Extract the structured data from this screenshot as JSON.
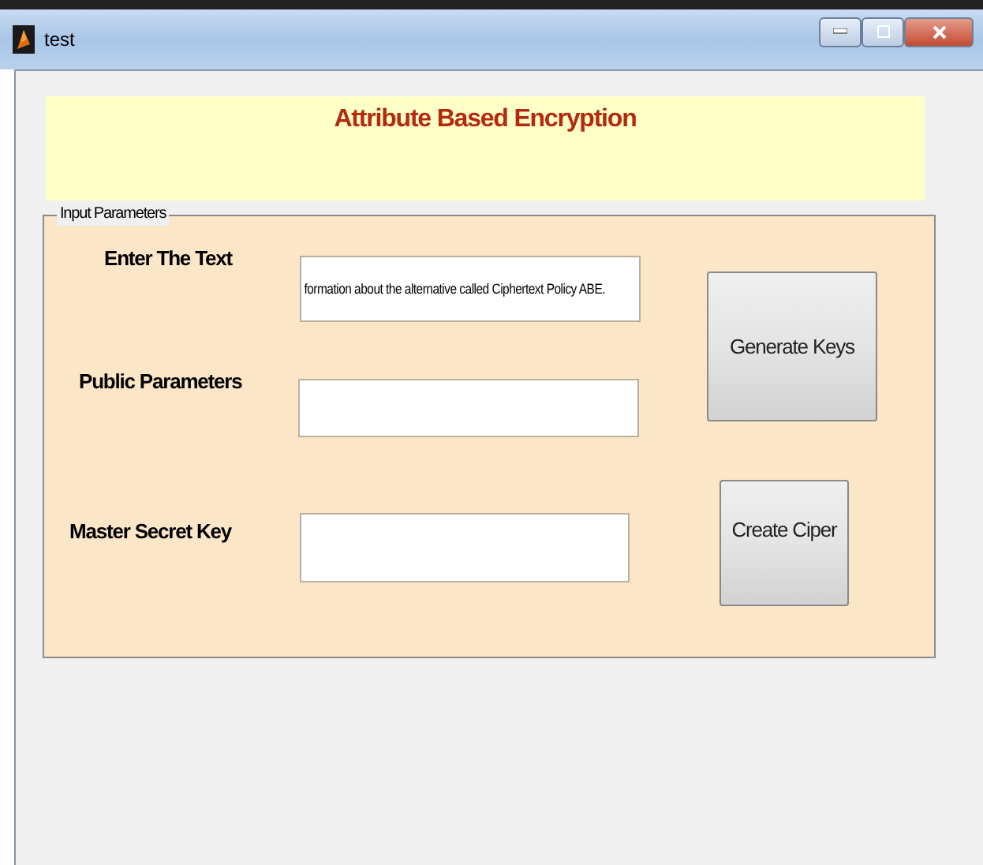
{
  "window": {
    "title": "test"
  },
  "banner": {
    "title": "Attribute Based Encryption"
  },
  "panel": {
    "title": "Input Parameters",
    "fields": [
      {
        "label": "Enter The Text",
        "value": "formation about the alternative called Ciphertext Policy ABE."
      },
      {
        "label": "Public Parameters"
      },
      {
        "label": "Master Secret Key"
      }
    ],
    "buttons": [
      "Generate Keys",
      "Create Ciper"
    ]
  }
}
